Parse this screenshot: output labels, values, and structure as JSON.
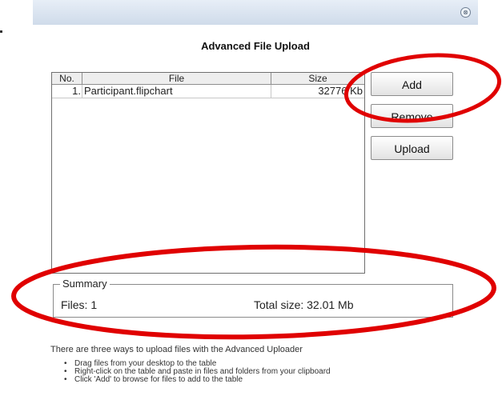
{
  "window": {
    "close_icon": "close-icon",
    "close_glyph": "⊗"
  },
  "dialog": {
    "title": "Advanced File Upload"
  },
  "table": {
    "headers": {
      "no": "No.",
      "file": "File",
      "size": "Size"
    },
    "rows": [
      {
        "no": "1.",
        "file": "Participant.flipchart",
        "size": "32776 Kb"
      }
    ]
  },
  "buttons": {
    "add": "Add",
    "remove": "Remove",
    "upload": "Upload"
  },
  "summary": {
    "legend": "Summary",
    "files": "Files: 1",
    "total_size": "Total size: 32.01 Mb"
  },
  "help": {
    "intro": "There are three ways to upload files with the Advanced Uploader",
    "items": [
      "Drag files from your desktop to the table",
      "Right-click on the table and paste in files and folders from your clipboard",
      "Click 'Add' to browse for files to add to the table"
    ]
  },
  "colors": {
    "annotation_red": "#e00000",
    "titlebar": "#d8e3ef"
  }
}
